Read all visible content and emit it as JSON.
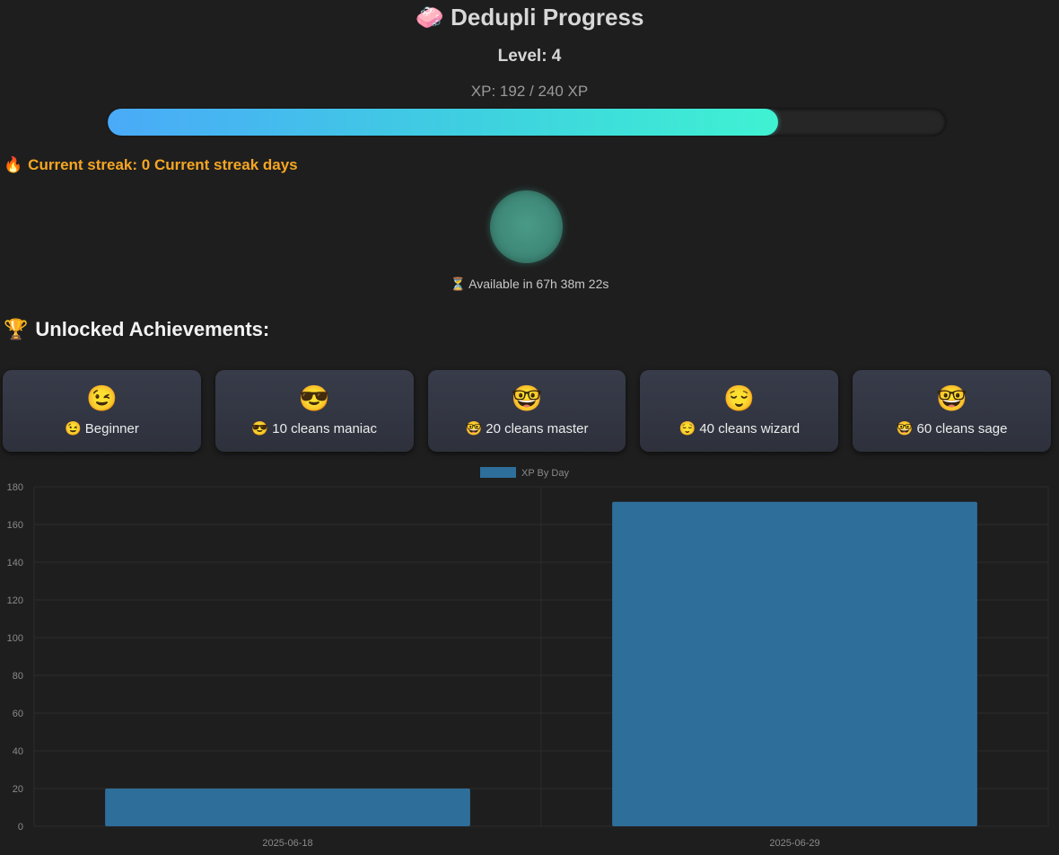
{
  "header": {
    "title": "🧼 Dedupli Progress",
    "level_text": "Level: 4",
    "xp_text": "XP: 192 / 240 XP",
    "xp_current": 192,
    "xp_max": 240
  },
  "streak": {
    "icon": "🔥",
    "text": "Current streak: 0 Current streak days",
    "color": "#f5a623"
  },
  "cooldown": {
    "available_text": "⏳ Available in 67h 38m 22s"
  },
  "achievements": {
    "icon": "🏆",
    "title": "Unlocked Achievements:",
    "items": [
      {
        "emoji": "😉",
        "label": "😉 Beginner"
      },
      {
        "emoji": "😎",
        "label": "😎 10 cleans maniac"
      },
      {
        "emoji": "🤓",
        "label": "🤓 20 cleans master"
      },
      {
        "emoji": "😌",
        "label": "😌 40 cleans wizard"
      },
      {
        "emoji": "🤓",
        "label": "🤓 60 cleans sage"
      }
    ]
  },
  "colors": {
    "background": "#1e1e1e",
    "accent_gradient_start": "#4aaaf8",
    "accent_gradient_end": "#3ff2d2",
    "bar_color": "#2e6e9a"
  },
  "chart_data": {
    "type": "bar",
    "categories": [
      "2025-06-18",
      "2025-06-29"
    ],
    "series": [
      {
        "name": "XP By Day",
        "values": [
          20,
          172
        ]
      }
    ],
    "ylim": [
      0,
      180
    ],
    "yticks": [
      0,
      20,
      40,
      60,
      80,
      100,
      120,
      140,
      160,
      180
    ],
    "grid": true,
    "legend": "top-center"
  }
}
